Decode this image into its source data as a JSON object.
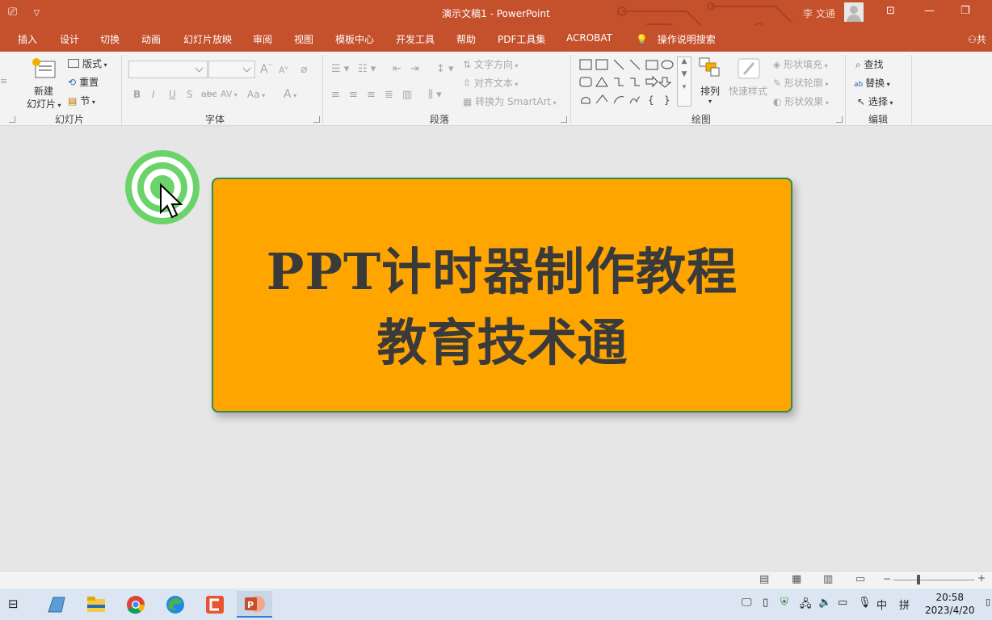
{
  "titlebar": {
    "title": "演示文稿1  -  PowerPoint",
    "user": "李 文通",
    "colors": {
      "accent": "#c4502c"
    }
  },
  "tabs": [
    "插入",
    "设计",
    "切换",
    "动画",
    "幻灯片放映",
    "审阅",
    "视图",
    "模板中心",
    "开发工具",
    "帮助",
    "PDF工具集",
    "ACROBAT",
    "操作说明搜索",
    "共"
  ],
  "ribbon": {
    "slides": {
      "new_slide_line1": "新建",
      "new_slide_line2": "幻灯片",
      "layout": "版式",
      "reset": "重置",
      "section": "节",
      "label": "幻灯片"
    },
    "font": {
      "label": "字体",
      "bold": "B",
      "italic": "I",
      "underline": "U",
      "shadow": "S",
      "strike": "abc",
      "spacing": "AV",
      "case": "Aa",
      "color": "A",
      "grow": "A",
      "shrink": "A"
    },
    "paragraph": {
      "label": "段落",
      "text_direction": "文字方向",
      "align_text": "对齐文本",
      "smartart": "转换为 SmartArt"
    },
    "drawing": {
      "label": "绘图",
      "arrange": "排列",
      "quick_styles": "快速样式",
      "shape_fill": "形状填充",
      "shape_outline": "形状轮廓",
      "shape_effects": "形状效果"
    },
    "editing": {
      "label": "编辑",
      "find": "查找",
      "replace": "替换",
      "select": "选择"
    }
  },
  "slide": {
    "line1": "PPT计时器制作教程",
    "line2": "教育技术通",
    "fill_color": "#ffa500",
    "border_color": "#2e8b57"
  },
  "statusbar": {
    "zoom_minus": "−",
    "zoom_plus": "+"
  },
  "taskbar": {
    "time": "20:58",
    "date": "2023/4/20",
    "ime_lang": "中",
    "ime_mode": "拼"
  }
}
